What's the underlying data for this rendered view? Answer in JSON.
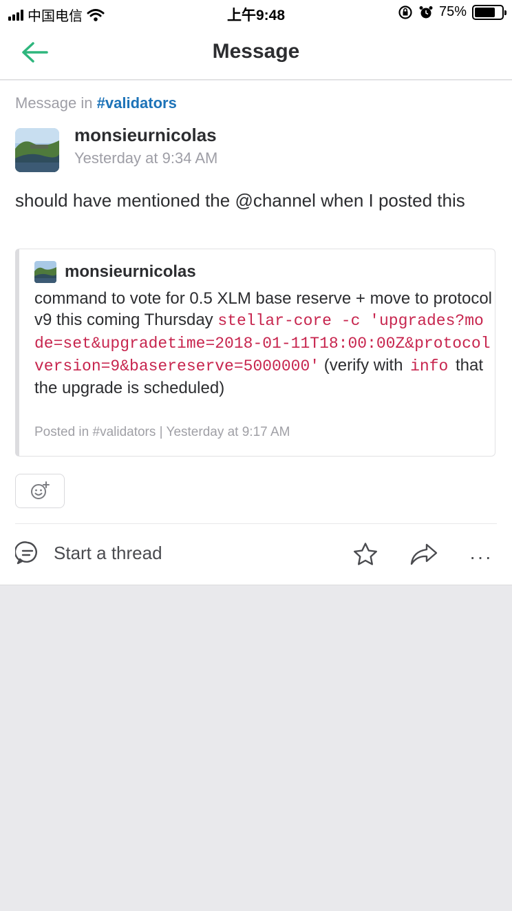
{
  "status_bar": {
    "carrier": "中国电信",
    "time": "上午9:48",
    "battery_percent": "75%",
    "battery_level": 0.75
  },
  "nav": {
    "title": "Message",
    "back_icon": "arrow-left-icon"
  },
  "message": {
    "context_prefix": "Message in",
    "channel": "#validators",
    "author": "monsieurnicolas",
    "timestamp": "Yesterday at 9:34 AM",
    "text": "should have mentioned the @channel when I posted this"
  },
  "quoted": {
    "author": "monsieurnicolas",
    "text_before": "command to vote for 0.5 XLM base reserve + move to protocol v9 this coming Thursday ",
    "code": "stellar-core -c 'upgrades?mode=set&upgradetime=2018-01-11T18:00:00Z&protocolversion=9&basereserve=5000000'",
    "text_mid": " (verify with ",
    "code2": "info",
    "text_after": " that the upgrade is scheduled)",
    "footer": "Posted in #validators | Yesterday at 9:17 AM"
  },
  "actions": {
    "thread_label": "Start a thread",
    "more_label": "···"
  },
  "colors": {
    "accent": "#2eb67d",
    "channel": "#1d73b8",
    "code": "#c7254e"
  }
}
